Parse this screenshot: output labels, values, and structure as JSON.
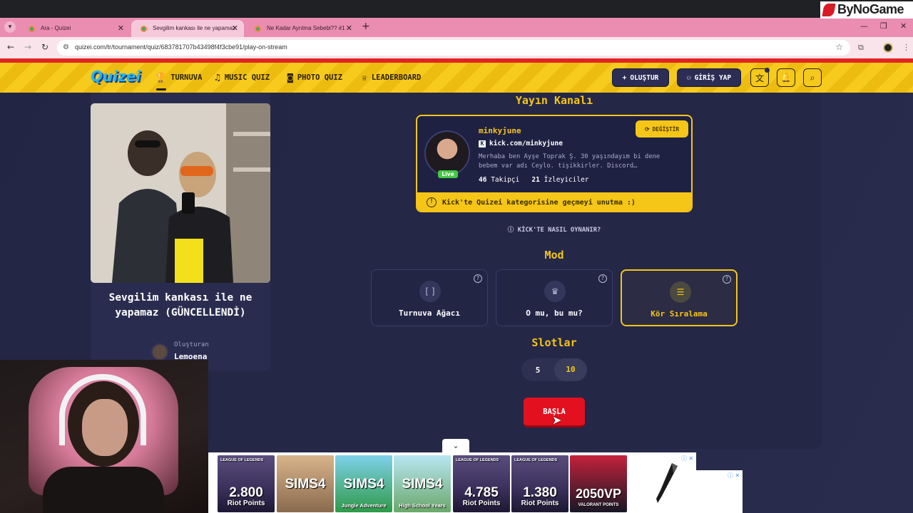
{
  "browser": {
    "tabs": [
      {
        "title": "Ara - Quizei",
        "active": false
      },
      {
        "title": "Sevgilim kankası ile ne yapamaz",
        "active": true
      },
      {
        "title": "Ne Kadar Ayrılma Sebebi?? #1",
        "active": false
      }
    ],
    "url": "quizei.com/tr/tournament/quiz/683781707b43498f4f3cbe91/play-on-stream"
  },
  "header": {
    "logo": "Quizei",
    "nav": [
      {
        "label": "TURNUVA",
        "icon": "trophy-icon"
      },
      {
        "label": "MUSIC QUIZ",
        "icon": "music-note-icon"
      },
      {
        "label": "PHOTO QUIZ",
        "icon": "camera-icon"
      },
      {
        "label": "LEADERBOARD",
        "icon": "medal-icon"
      }
    ],
    "create_label": "OLUŞTUR",
    "login_label": "GİRİŞ YAP"
  },
  "quiz": {
    "title": "Sevgilim kankası ile ne yapamaz (GÜNCELLENDİ)",
    "creator_label": "Oluşturan",
    "creator_name": "Lemoena"
  },
  "stream": {
    "section_title": "Yayın Kanalı",
    "name": "minkyjune",
    "url": "kick.com/minkyjune",
    "bio_line1": "Merhaba ben Ayşe Toprak Ş. 30 yaşındayım bi dene",
    "bio_line2": "bebem var adı Ceylo. tişikkirler. Discord…",
    "followers": "46",
    "followers_label": "Takipçi",
    "viewers": "21",
    "viewers_label": "İzleyiciler",
    "live_label": "Live",
    "change_label": "DEĞİŞTİR",
    "notice": "Kick'te Quizei kategorisine geçmeyi unutma :)",
    "howto": "KİCK'TE NASIL OYNANIR?"
  },
  "mode": {
    "section_title": "Mod",
    "options": [
      {
        "label": "Turnuva Ağacı",
        "icon": "bracket-icon",
        "selected": false
      },
      {
        "label": "O mu, bu mu?",
        "icon": "crown-icon",
        "selected": false
      },
      {
        "label": "Kör Sıralama",
        "icon": "list-icon",
        "selected": true
      }
    ]
  },
  "slots": {
    "section_title": "Slotlar",
    "options": [
      "5",
      "10"
    ],
    "selected": "10"
  },
  "start_label": "BAŞLA",
  "ads": [
    {
      "line1": "2.800",
      "line2": "Riot Points",
      "kind": "riot"
    },
    {
      "line1": "SIMS4",
      "line2": "",
      "kind": "sims1"
    },
    {
      "line1": "SIMS4",
      "line2": "Jungle Adventure",
      "kind": "sims2"
    },
    {
      "line1": "SIMS4",
      "line2": "High School Years",
      "kind": "sims3"
    },
    {
      "line1": "4.785",
      "line2": "Riot Points",
      "kind": "riot"
    },
    {
      "line1": "1.380",
      "line2": "Riot Points",
      "kind": "riot"
    },
    {
      "line1": "2050VP",
      "line2": "VALORANT POINTS",
      "kind": "val"
    }
  ],
  "ad_label": "LEAGUE OF LEGENDS",
  "watermark": "ByNoGame"
}
